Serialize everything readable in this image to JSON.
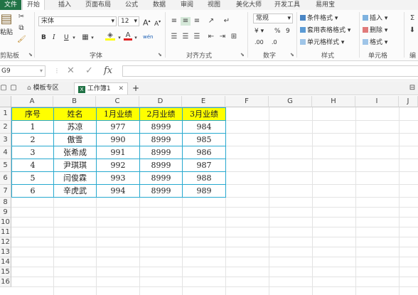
{
  "ribbon_tabs": [
    "文件",
    "开始",
    "插入",
    "页面布局",
    "公式",
    "数据",
    "审阅",
    "视图",
    "美化大师",
    "开发工具",
    "易用宝"
  ],
  "clipboard": {
    "paste_label": "粘贴",
    "group_label": "剪贴板"
  },
  "font_group": {
    "font_name": "宋体",
    "font_size": "12",
    "grow_label": "A",
    "shrink_label": "A",
    "bold_label": "B",
    "italic_label": "I",
    "underline_label": "U",
    "font_color_label": "A",
    "phonetic_label": "wén",
    "group_label": "字体"
  },
  "alignment_group": {
    "group_label": "对齐方式"
  },
  "number_group": {
    "format_value": "常规",
    "currency_label": "¥",
    "percent_label": "%",
    "comma_label": "9",
    "inc_decimal_label": ".00",
    "dec_decimal_label": ".0",
    "group_label": "数字"
  },
  "styles_group": {
    "conditional_format": "条件格式",
    "table_format": "套用表格格式",
    "cell_styles": "单元格样式",
    "group_label": "样式"
  },
  "cells_group": {
    "insert": "插入",
    "delete": "删除",
    "format": "格式",
    "group_label": "单元格"
  },
  "edit_group": {
    "group_label": "编"
  },
  "formula_bar": {
    "name_box": "G9",
    "fx_label": "fx"
  },
  "doc_tabs": {
    "template_tab": "模板专区",
    "workbook_tab": "工作簿1",
    "add_label": "+"
  },
  "columns": [
    "A",
    "B",
    "C",
    "D",
    "E",
    "F",
    "G",
    "H",
    "I",
    "J"
  ],
  "rows": [
    "1",
    "2",
    "3",
    "4",
    "5",
    "6",
    "7",
    "8",
    "9",
    "10",
    "11",
    "12",
    "13",
    "14",
    "15",
    "16"
  ],
  "table": {
    "headers": [
      "序号",
      "姓名",
      "1月业绩",
      "2月业绩",
      "3月业绩"
    ],
    "data": [
      [
        "1",
        "苏凉",
        "977",
        "8999",
        "984"
      ],
      [
        "2",
        "傲雪",
        "990",
        "8999",
        "985"
      ],
      [
        "3",
        "张希成",
        "991",
        "8999",
        "986"
      ],
      [
        "4",
        "尹琪琪",
        "992",
        "8999",
        "987"
      ],
      [
        "5",
        "闫俊霖",
        "993",
        "8999",
        "988"
      ],
      [
        "6",
        "辛虎武",
        "994",
        "8999",
        "989"
      ]
    ]
  },
  "colors": {
    "accent": "#217346",
    "header_fill": "#ffff00",
    "table_border": "#27a9cf"
  }
}
